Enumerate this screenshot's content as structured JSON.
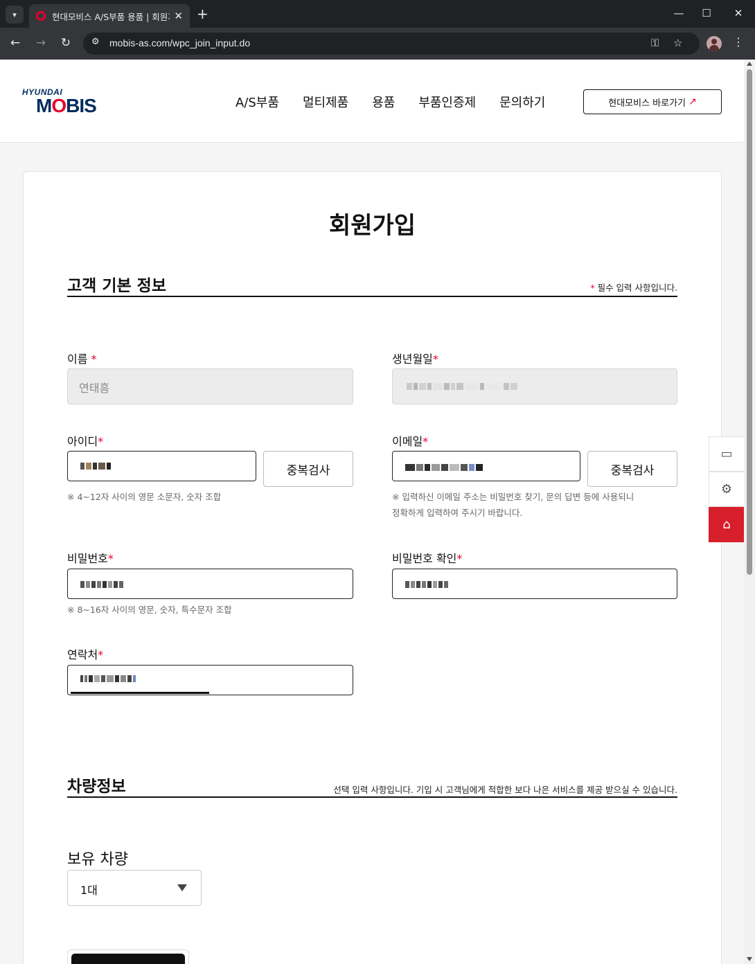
{
  "browser": {
    "tab_title": "현대모비스 A/S부품 용품 | 회원가입",
    "tab_close": "✕",
    "new_tab": "+",
    "url": "mobis-as.com/wpc_join_input.do",
    "win_min": "—",
    "win_max": "☐",
    "win_close": "✕"
  },
  "header": {
    "logo_top": "HYUNDAI",
    "logo_main_1": "M",
    "logo_main_o": "O",
    "logo_main_2": "BIS",
    "nav": [
      "A/S부품",
      "멀티제품",
      "용품",
      "부품인증제",
      "문의하기"
    ],
    "external_link": "현대모비스 바로가기",
    "external_arrow": "↗"
  },
  "page": {
    "title": "회원가입"
  },
  "basic_section": {
    "title": "고객 기본 정보",
    "note_star": "*",
    "note": " 필수 입력 사항입니다."
  },
  "form": {
    "name_label": "이름",
    "name_value": "연태흠",
    "birth_label": "생년월일",
    "id_label": "아이디",
    "email_label": "이메일",
    "dup_check": "중복검사",
    "id_hint": "※ 4~12자 사이의 영문 소문자, 숫자 조합",
    "email_hint_1": "※ 입력하신 이메일 주소는 비밀번호 찾기, 문의 답변 등에 사용되니",
    "email_hint_2": "정확하게 입력하여 주시기 바랍니다.",
    "pw_label": "비밀번호",
    "pw_confirm_label": "비밀번호 확인",
    "pw_hint": "※ 8~16자 사이의 영문, 숫자, 특수문자 조합",
    "phone_label": "연락처",
    "required_mark": "*"
  },
  "vehicle_section": {
    "title": "차량정보",
    "note": "선택 입력 사항입니다. 기입 시 고객님에게 적합한 보다 나은 서비스를 제공 받으실 수 있습니다.",
    "owned_label": "보유 차량",
    "owned_value": "1대"
  },
  "colors": {
    "brand_red": "#e4002b",
    "brand_navy": "#002c5f",
    "home_button": "#d71f2b"
  }
}
